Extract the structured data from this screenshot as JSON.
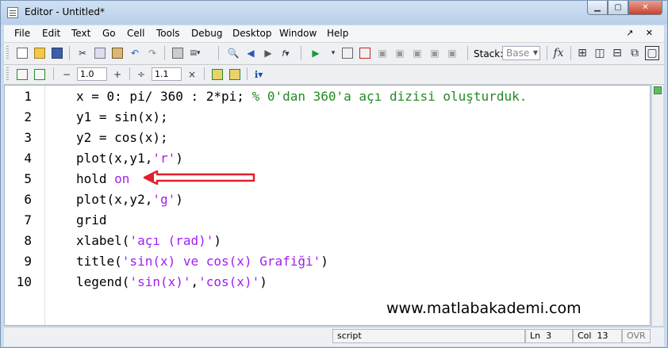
{
  "window": {
    "title": "Editor - Untitled*",
    "min": "▁",
    "max": "▢",
    "close": "✕"
  },
  "menu": {
    "items": [
      "File",
      "Edit",
      "Text",
      "Go",
      "Cell",
      "Tools",
      "Debug",
      "Desktop",
      "Window",
      "Help"
    ],
    "right": "↗ ✕"
  },
  "toolbar": {
    "stack_label": "Stack:",
    "stack_value": "Base",
    "fx": "fx",
    "cell_minus": "−",
    "cell_value_1": "1.0",
    "cell_plus": "+",
    "cell_div": "÷",
    "cell_value_2": "1.1",
    "cell_times": "×"
  },
  "code": {
    "line_numbers": [
      "1",
      "2",
      "3",
      "4",
      "5",
      "6",
      "7",
      "8",
      "9",
      "10"
    ],
    "lines": [
      [
        {
          "t": "x = 0: pi/ 360 : 2*pi; ",
          "c": ""
        },
        {
          "t": "% 0'dan 360'a açı dizisi oluşturduk.",
          "c": "cm"
        }
      ],
      [
        {
          "t": "y1 = sin(x);",
          "c": ""
        }
      ],
      [
        {
          "t": "y2 = cos(x);",
          "c": ""
        }
      ],
      [
        {
          "t": "plot(x,y1,",
          "c": ""
        },
        {
          "t": "'r'",
          "c": "str"
        },
        {
          "t": ")",
          "c": ""
        }
      ],
      [
        {
          "t": "hold ",
          "c": ""
        },
        {
          "t": "on",
          "c": "str"
        }
      ],
      [
        {
          "t": "plot(x,y2,",
          "c": ""
        },
        {
          "t": "'g'",
          "c": "str"
        },
        {
          "t": ")",
          "c": ""
        }
      ],
      [
        {
          "t": "grid",
          "c": ""
        }
      ],
      [
        {
          "t": "xlabel(",
          "c": ""
        },
        {
          "t": "'açı (rad)'",
          "c": "str"
        },
        {
          "t": ")",
          "c": ""
        }
      ],
      [
        {
          "t": "title(",
          "c": ""
        },
        {
          "t": "'sin(x) ve cos(x) Grafiği'",
          "c": "str"
        },
        {
          "t": ")",
          "c": ""
        }
      ],
      [
        {
          "t": "legend(",
          "c": ""
        },
        {
          "t": "'sin(x)'",
          "c": "str"
        },
        {
          "t": ",",
          "c": ""
        },
        {
          "t": "'cos(x)'",
          "c": "str"
        },
        {
          "t": ")",
          "c": ""
        }
      ]
    ],
    "watermark": "www.matlabakademi.com"
  },
  "status": {
    "mode": "script",
    "ln_label": "Ln",
    "ln": "3",
    "col_label": "Col",
    "col": "13",
    "ovr": "OVR"
  },
  "colors": {
    "keyword": "#0000ff",
    "string": "#a020f0",
    "comment": "#228b22",
    "arrow": "#e0202a"
  }
}
